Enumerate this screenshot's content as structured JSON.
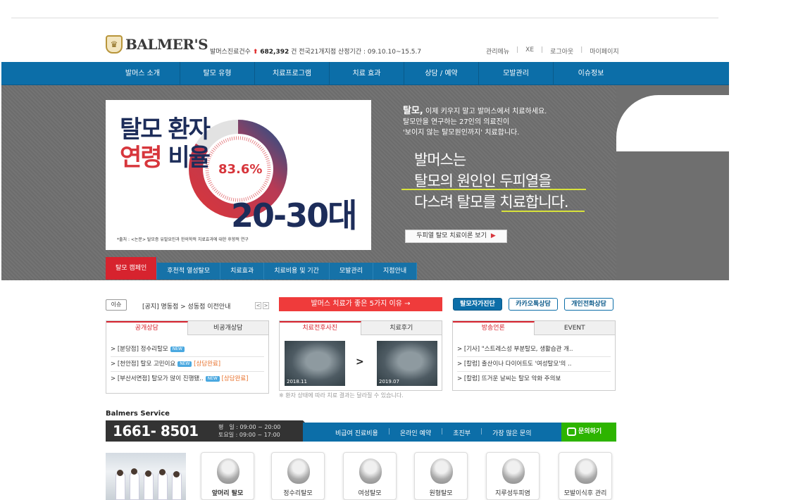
{
  "header": {
    "brand": "BALMER'S",
    "stats_prefix": "발머스진료건수",
    "stats_count": "682,392",
    "stats_suffix": "건 전국21개지점 산정기간 : 09.10.10~15.5.7",
    "utility": [
      "관리메뉴",
      "XE",
      "로그아웃",
      "마이페이지"
    ]
  },
  "nav": [
    "발머스 소개",
    "탈모 유형",
    "치료프로그램",
    "치료 효과",
    "상담 / 예약",
    "모발관리",
    "이슈정보"
  ],
  "hero": {
    "panel_title_1": "탈모 환자",
    "panel_title_2a": "연령",
    "panel_title_2b": "비율",
    "percent": "83.6%",
    "age": "20-30대",
    "source": "*출처 : <논문> 탈모증 유발요인과 한의학적 치료효과에 대한 후향적 연구",
    "copy_bold": "탈모,",
    "copy_line1": " 이제 키우지 말고 발머스에서 치료하세요.",
    "copy_line2": "탈모만을 연구하는 27인의 의료진이",
    "copy_line3": "'보이지 않는 탈모원인까지' 치료합니다.",
    "big_line1": "발머스는",
    "big_line2": "탈모의 원인인 두피열을",
    "big_line3": "다스려 탈모를 치료합니다.",
    "button": "두피열 탈모 치료이론 보기",
    "tabs": [
      "탈모 캠페인",
      "후천적 열성탈모",
      "치료효과",
      "치료비용 및 기간",
      "모발관리",
      "지점안내"
    ]
  },
  "notice": {
    "tag": "이슈",
    "text": "[공지] 명동점 > 성동점 이전안내",
    "banner": "발머스 치료가 좋은 5가지 이유 →",
    "pills": [
      "탈모자가진단",
      "카카오톡상담",
      "개인전화상담"
    ]
  },
  "consult_box": {
    "tabs": [
      "공개상담",
      "비공개상담"
    ],
    "items": [
      {
        "text": "> [분당점] 정수리탈모",
        "new": "NEW",
        "status": ""
      },
      {
        "text": "> [천안점] 탈모 고민이요",
        "new": "NEW",
        "status": "[상담완료]"
      },
      {
        "text": "> [부산서면점] 탈모가 많이 진행됐..",
        "new": "NEW",
        "status": "[상담완료]"
      }
    ]
  },
  "photo_box": {
    "tabs": [
      "치료전후사진",
      "치료후기"
    ],
    "before_date": "2018.11",
    "after_date": "2019.07",
    "arrow": ">",
    "note": "※ 환자 상태에 따라 치료 결과는 달라질 수 있습니다."
  },
  "media_box": {
    "tabs": [
      "방송언론",
      "EVENT"
    ],
    "items": [
      "> [기사] \"스트레스성 부분탈모, 생활습관 개..",
      "> [칼럼] 출산이나 다이어트도 '여성탈모'의 ..",
      "> [칼럼] 뜨거운 날씨는 탈모 악화 주의보"
    ]
  },
  "service": {
    "title": "Balmers Service",
    "phone": "1661- 8501",
    "hours1": "평　일 : 09:00 ~ 20:00",
    "hours2": "토요일 : 09:00 ~ 17:00",
    "links": [
      "비급여 진료비용",
      "온라인 예약",
      "초진부",
      "가장 많은 문의"
    ],
    "kakao": "문의하기",
    "cards": [
      "앞머리 탈모",
      "정수리탈모",
      "여성탈모",
      "원형탈모",
      "지루성두피염",
      "모발이식후 관리"
    ]
  },
  "colors": {
    "nav_blue": "#0c6ea8",
    "accent_red": "#d7232e",
    "kakao_green": "#2db400",
    "hero_gray": "#6f6f6f"
  }
}
